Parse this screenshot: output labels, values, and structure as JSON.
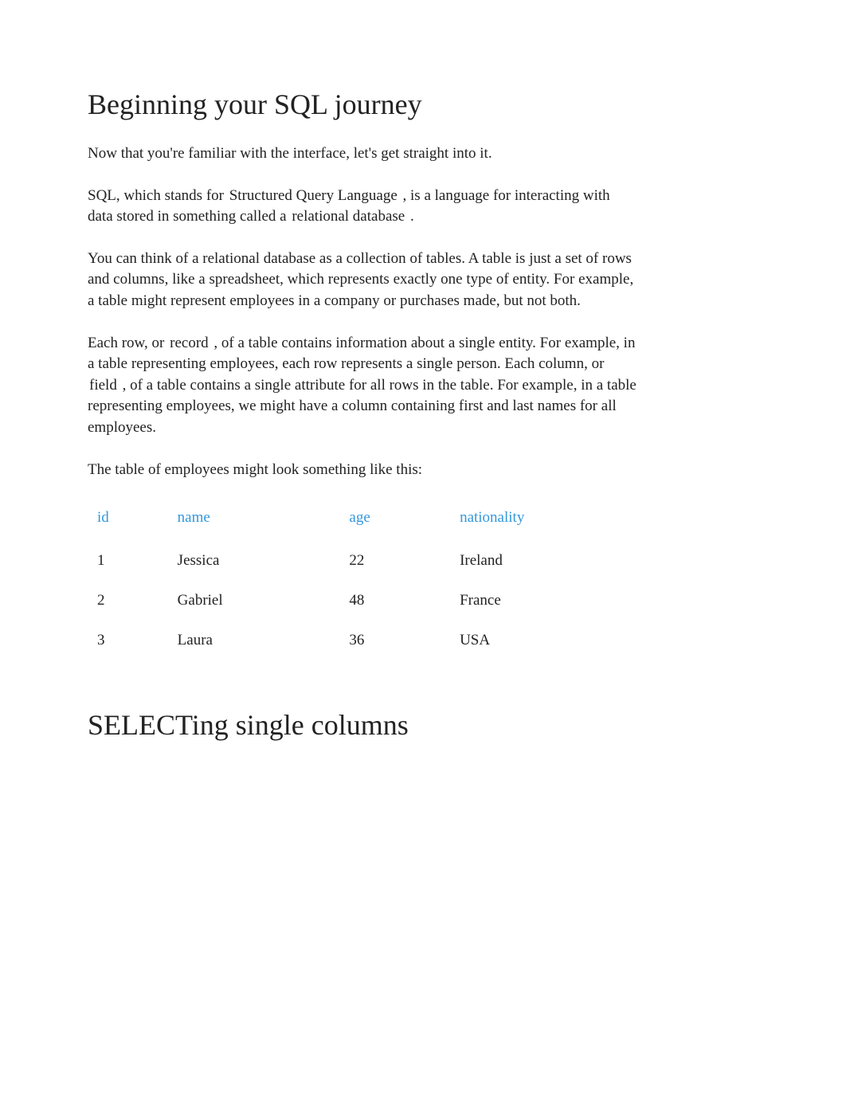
{
  "heading1": "Beginning your SQL journey",
  "p1": "Now that you're familiar with the interface, let's get straight into it.",
  "p2a": "SQL, which stands for ",
  "p2_term1": "Structured Query Language",
  "p2b": ", is a language for interacting with data stored in something called a ",
  "p2_term2": "relational database",
  "p2c": ".",
  "p3": "You can think of a relational database as a collection of tables. A table is just a set of rows and columns, like a spreadsheet, which represents exactly one type of entity. For example, a table might represent employees in a company or purchases made, but not both.",
  "p4a": "Each row, or ",
  "p4_term1": "record",
  "p4b": ", of a table contains information about a single entity. For example, in a table representing employees, each row represents a single person. Each column, or ",
  "p4_term2": "field",
  "p4c": ", of a table contains a single attribute for all rows in the table. For example, in a table representing employees, we might have a column containing first and last names for all employees.",
  "p5": "The table of employees might look something like this:",
  "table": {
    "headers": [
      "id",
      "name",
      "age",
      "nationality"
    ],
    "rows": [
      [
        "1",
        "Jessica",
        "22",
        "Ireland"
      ],
      [
        "2",
        "Gabriel",
        "48",
        "France"
      ],
      [
        "3",
        "Laura",
        "36",
        "USA"
      ]
    ]
  },
  "heading2": "SELECTing single columns"
}
